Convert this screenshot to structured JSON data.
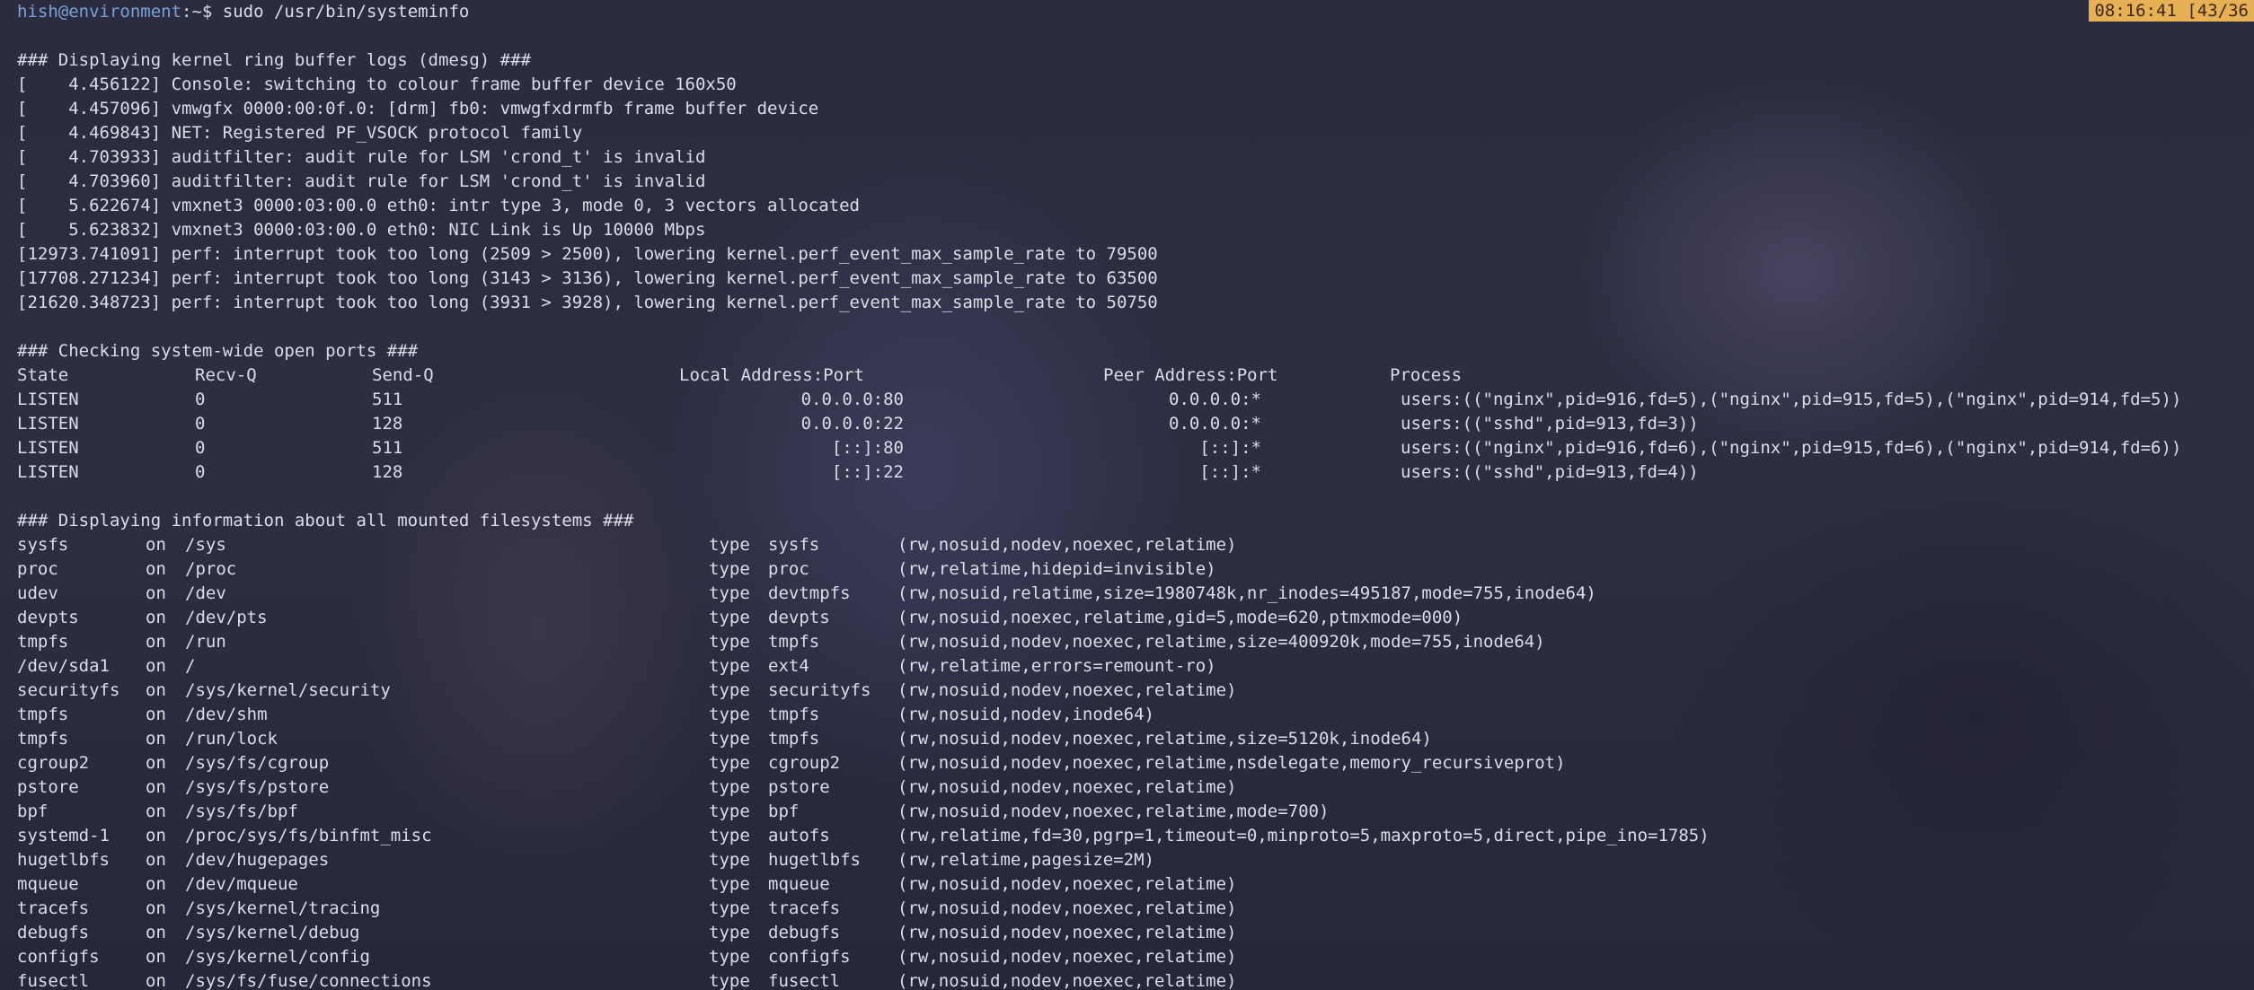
{
  "prompt": {
    "user_host": "hish@environment",
    "path_symbol": ":~$ ",
    "command": "sudo /usr/bin/systeminfo"
  },
  "status": {
    "clock": "08:16:41 [43/36"
  },
  "dmesg": {
    "header": "### Displaying kernel ring buffer logs (dmesg) ###",
    "lines": [
      "[    4.456122] Console: switching to colour frame buffer device 160x50",
      "[    4.457096] vmwgfx 0000:00:0f.0: [drm] fb0: vmwgfxdrmfb frame buffer device",
      "[    4.469843] NET: Registered PF_VSOCK protocol family",
      "[    4.703933] auditfilter: audit rule for LSM 'crond_t' is invalid",
      "[    4.703960] auditfilter: audit rule for LSM 'crond_t' is invalid",
      "[    5.622674] vmxnet3 0000:03:00.0 eth0: intr type 3, mode 0, 3 vectors allocated",
      "[    5.623832] vmxnet3 0000:03:00.0 eth0: NIC Link is Up 10000 Mbps",
      "[12973.741091] perf: interrupt took too long (2509 > 2500), lowering kernel.perf_event_max_sample_rate to 79500",
      "[17708.271234] perf: interrupt took too long (3143 > 3136), lowering kernel.perf_event_max_sample_rate to 63500",
      "[21620.348723] perf: interrupt took too long (3931 > 3928), lowering kernel.perf_event_max_sample_rate to 50750"
    ]
  },
  "ports": {
    "header": "### Checking system-wide open ports ###",
    "columns": {
      "state": "State",
      "recvq": "Recv-Q",
      "sendq": "Send-Q",
      "local": "Local Address:Port",
      "peer": "Peer Address:Port",
      "process": "Process"
    },
    "rows": [
      {
        "state": "LISTEN",
        "recvq": "0",
        "sendq": "511",
        "local": "0.0.0.0:80",
        "peer": "0.0.0.0:*",
        "process": "users:((\"nginx\",pid=916,fd=5),(\"nginx\",pid=915,fd=5),(\"nginx\",pid=914,fd=5))"
      },
      {
        "state": "LISTEN",
        "recvq": "0",
        "sendq": "128",
        "local": "0.0.0.0:22",
        "peer": "0.0.0.0:*",
        "process": "users:((\"sshd\",pid=913,fd=3))"
      },
      {
        "state": "LISTEN",
        "recvq": "0",
        "sendq": "511",
        "local": "[::]:80",
        "peer": "[::]:*",
        "process": "users:((\"nginx\",pid=916,fd=6),(\"nginx\",pid=915,fd=6),(\"nginx\",pid=914,fd=6))"
      },
      {
        "state": "LISTEN",
        "recvq": "0",
        "sendq": "128",
        "local": "[::]:22",
        "peer": "[::]:*",
        "process": "users:((\"sshd\",pid=913,fd=4))"
      }
    ]
  },
  "mounts": {
    "header": "### Displaying information about all mounted filesystems ###",
    "rows": [
      {
        "dev": "sysfs",
        "on": "on",
        "path": "/sys",
        "type": "type",
        "fstype": "sysfs",
        "opts": "(rw,nosuid,nodev,noexec,relatime)"
      },
      {
        "dev": "proc",
        "on": "on",
        "path": "/proc",
        "type": "type",
        "fstype": "proc",
        "opts": "(rw,relatime,hidepid=invisible)"
      },
      {
        "dev": "udev",
        "on": "on",
        "path": "/dev",
        "type": "type",
        "fstype": "devtmpfs",
        "opts": "(rw,nosuid,relatime,size=1980748k,nr_inodes=495187,mode=755,inode64)"
      },
      {
        "dev": "devpts",
        "on": "on",
        "path": "/dev/pts",
        "type": "type",
        "fstype": "devpts",
        "opts": "(rw,nosuid,noexec,relatime,gid=5,mode=620,ptmxmode=000)"
      },
      {
        "dev": "tmpfs",
        "on": "on",
        "path": "/run",
        "type": "type",
        "fstype": "tmpfs",
        "opts": "(rw,nosuid,nodev,noexec,relatime,size=400920k,mode=755,inode64)"
      },
      {
        "dev": "/dev/sda1",
        "on": "on",
        "path": "/",
        "type": "type",
        "fstype": "ext4",
        "opts": "(rw,relatime,errors=remount-ro)"
      },
      {
        "dev": "securityfs",
        "on": "on",
        "path": "/sys/kernel/security",
        "type": "type",
        "fstype": "securityfs",
        "opts": "(rw,nosuid,nodev,noexec,relatime)"
      },
      {
        "dev": "tmpfs",
        "on": "on",
        "path": "/dev/shm",
        "type": "type",
        "fstype": "tmpfs",
        "opts": "(rw,nosuid,nodev,inode64)"
      },
      {
        "dev": "tmpfs",
        "on": "on",
        "path": "/run/lock",
        "type": "type",
        "fstype": "tmpfs",
        "opts": "(rw,nosuid,nodev,noexec,relatime,size=5120k,inode64)"
      },
      {
        "dev": "cgroup2",
        "on": "on",
        "path": "/sys/fs/cgroup",
        "type": "type",
        "fstype": "cgroup2",
        "opts": "(rw,nosuid,nodev,noexec,relatime,nsdelegate,memory_recursiveprot)"
      },
      {
        "dev": "pstore",
        "on": "on",
        "path": "/sys/fs/pstore",
        "type": "type",
        "fstype": "pstore",
        "opts": "(rw,nosuid,nodev,noexec,relatime)"
      },
      {
        "dev": "bpf",
        "on": "on",
        "path": "/sys/fs/bpf",
        "type": "type",
        "fstype": "bpf",
        "opts": "(rw,nosuid,nodev,noexec,relatime,mode=700)"
      },
      {
        "dev": "systemd-1",
        "on": "on",
        "path": "/proc/sys/fs/binfmt_misc",
        "type": "type",
        "fstype": "autofs",
        "opts": "(rw,relatime,fd=30,pgrp=1,timeout=0,minproto=5,maxproto=5,direct,pipe_ino=1785)"
      },
      {
        "dev": "hugetlbfs",
        "on": "on",
        "path": "/dev/hugepages",
        "type": "type",
        "fstype": "hugetlbfs",
        "opts": "(rw,relatime,pagesize=2M)"
      },
      {
        "dev": "mqueue",
        "on": "on",
        "path": "/dev/mqueue",
        "type": "type",
        "fstype": "mqueue",
        "opts": "(rw,nosuid,nodev,noexec,relatime)"
      },
      {
        "dev": "tracefs",
        "on": "on",
        "path": "/sys/kernel/tracing",
        "type": "type",
        "fstype": "tracefs",
        "opts": "(rw,nosuid,nodev,noexec,relatime)"
      },
      {
        "dev": "debugfs",
        "on": "on",
        "path": "/sys/kernel/debug",
        "type": "type",
        "fstype": "debugfs",
        "opts": "(rw,nosuid,nodev,noexec,relatime)"
      },
      {
        "dev": "configfs",
        "on": "on",
        "path": "/sys/kernel/config",
        "type": "type",
        "fstype": "configfs",
        "opts": "(rw,nosuid,nodev,noexec,relatime)"
      },
      {
        "dev": "fusectl",
        "on": "on",
        "path": "/sys/fs/fuse/connections",
        "type": "type",
        "fstype": "fusectl",
        "opts": "(rw,nosuid,nodev,noexec,relatime)"
      }
    ]
  }
}
